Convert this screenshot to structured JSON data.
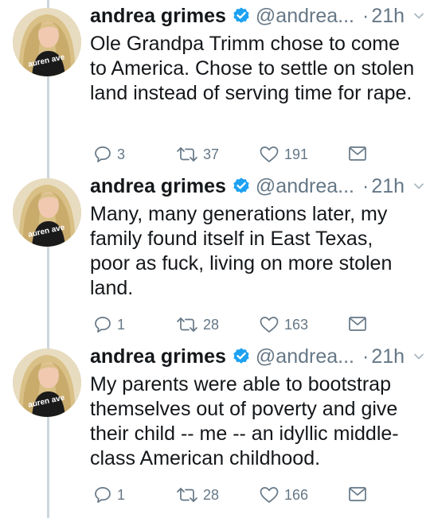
{
  "tweets": [
    {
      "name": "andrea grimes",
      "handle": "@andrea...",
      "dot": "·",
      "time": "21h",
      "text": "Ole Grandpa Trimm chose to come to America. Chose to settle on stolen land instead of serving time for rape.",
      "replies": "3",
      "retweets": "37",
      "likes": "191"
    },
    {
      "name": "andrea grimes",
      "handle": "@andrea...",
      "dot": "·",
      "time": "21h",
      "text": "Many, many generations later, my family found itself in East Texas, poor as fuck, living on more stolen land.",
      "replies": "1",
      "retweets": "28",
      "likes": "163"
    },
    {
      "name": "andrea grimes",
      "handle": "@andrea...",
      "dot": "·",
      "time": "21h",
      "text": "My parents were able to bootstrap themselves out of poverty and give their child -- me -- an idyllic middle-class American childhood.",
      "replies": "1",
      "retweets": "28",
      "likes": "166"
    }
  ],
  "avatar_caption": "auren ave",
  "colors": {
    "verified": "#1da1f2",
    "muted": "#657786",
    "thread_line": "#ccd6dd"
  },
  "icons": [
    "reply-icon",
    "retweet-icon",
    "like-icon",
    "direct-message-icon",
    "verified-icon",
    "chevron-down-icon"
  ]
}
